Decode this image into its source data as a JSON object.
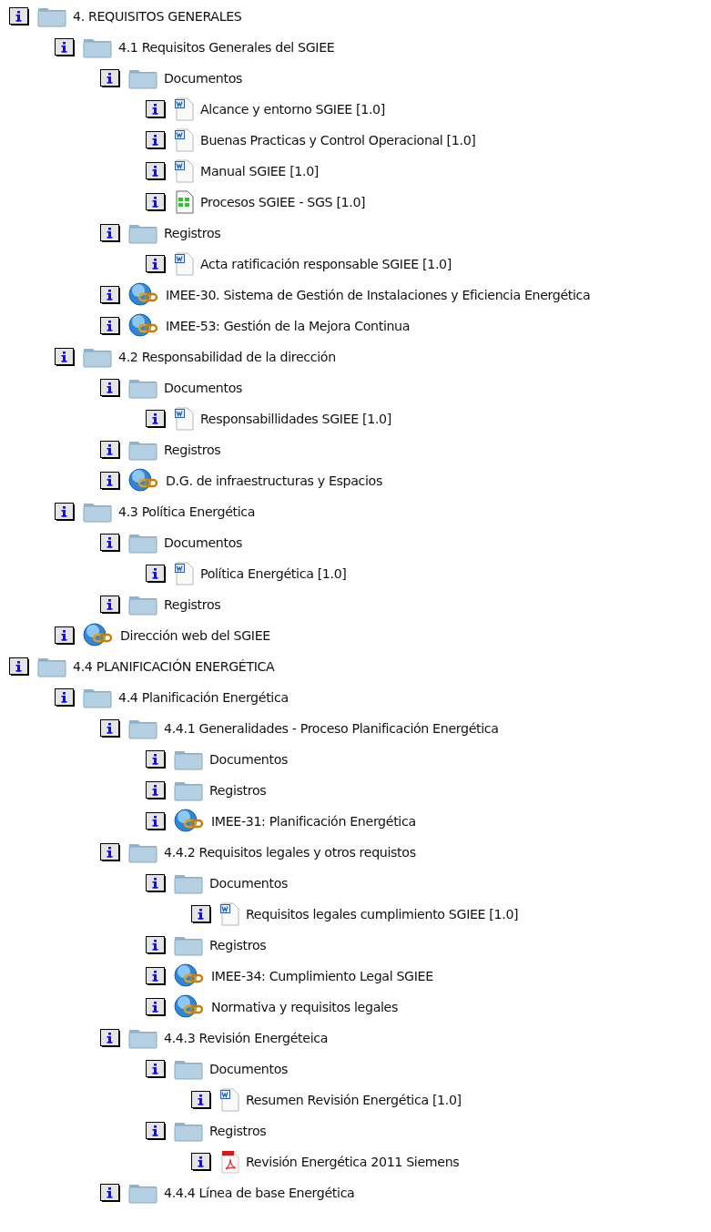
{
  "tree": [
    {
      "kind": "folder",
      "label": "4. REQUISITOS GENERALES",
      "children": [
        {
          "kind": "folder",
          "label": "4.1 Requisitos Generales del SGIEE",
          "children": [
            {
              "kind": "folder",
              "label": "Documentos",
              "children": [
                {
                  "kind": "word",
                  "label": "Alcance y entorno SGIEE [1.0]"
                },
                {
                  "kind": "word",
                  "label": "Buenas Practicas y Control Operacional [1.0]"
                },
                {
                  "kind": "word",
                  "label": "Manual SGIEE [1.0]"
                },
                {
                  "kind": "sheet",
                  "label": "Procesos SGIEE - SGS [1.0]"
                }
              ]
            },
            {
              "kind": "folder",
              "label": "Registros",
              "children": [
                {
                  "kind": "word",
                  "label": "Acta ratificación responsable SGIEE [1.0]"
                }
              ]
            },
            {
              "kind": "link",
              "label": "IMEE-30. Sistema de Gestión de Instalaciones y Eficiencia Energética"
            },
            {
              "kind": "link",
              "label": "IMEE-53: Gestión de la Mejora Continua"
            }
          ]
        },
        {
          "kind": "folder",
          "label": "4.2 Responsabilidad de la dirección",
          "children": [
            {
              "kind": "folder",
              "label": "Documentos",
              "children": [
                {
                  "kind": "word",
                  "label": "Responsabillidades SGIEE [1.0]"
                }
              ]
            },
            {
              "kind": "folder",
              "label": "Registros"
            },
            {
              "kind": "link",
              "label": "D.G. de infraestructuras y Espacios"
            }
          ]
        },
        {
          "kind": "folder",
          "label": "4.3 Política Energética",
          "children": [
            {
              "kind": "folder",
              "label": "Documentos",
              "children": [
                {
                  "kind": "word",
                  "label": "Política Energética [1.0]"
                }
              ]
            },
            {
              "kind": "folder",
              "label": "Registros"
            }
          ]
        },
        {
          "kind": "link",
          "label": "Dirección web del SGIEE"
        }
      ]
    },
    {
      "kind": "folder",
      "label": "4.4 PLANIFICACIÓN ENERGÉTICA",
      "children": [
        {
          "kind": "folder",
          "label": "4.4 Planificación Energética",
          "children": [
            {
              "kind": "folder",
              "label": "4.4.1 Generalidades - Proceso Planificación Energética",
              "children": [
                {
                  "kind": "folder",
                  "label": "Documentos"
                },
                {
                  "kind": "folder",
                  "label": "Registros"
                },
                {
                  "kind": "link",
                  "label": "IMEE-31: Planificación Energética"
                }
              ]
            },
            {
              "kind": "folder",
              "label": "4.4.2 Requisitos legales y otros requistos",
              "children": [
                {
                  "kind": "folder",
                  "label": "Documentos",
                  "children": [
                    {
                      "kind": "word",
                      "label": "Requisitos legales cumplimiento SGIEE [1.0]"
                    }
                  ]
                },
                {
                  "kind": "folder",
                  "label": "Registros"
                },
                {
                  "kind": "link",
                  "label": "IMEE-34: Cumplimiento Legal SGIEE"
                },
                {
                  "kind": "link",
                  "label": "Normativa y requisitos legales"
                }
              ]
            },
            {
              "kind": "folder",
              "label": "4.4.3 Revisión Energéteica",
              "children": [
                {
                  "kind": "folder",
                  "label": "Documentos",
                  "children": [
                    {
                      "kind": "word",
                      "label": "Resumen Revisión Energética [1.0]"
                    }
                  ]
                },
                {
                  "kind": "folder",
                  "label": "Registros",
                  "children": [
                    {
                      "kind": "pdf",
                      "label": "Revisión Energética 2011 Siemens"
                    }
                  ]
                }
              ]
            },
            {
              "kind": "folder",
              "label": "4.4.4 Línea de base Energética"
            }
          ]
        }
      ]
    }
  ]
}
